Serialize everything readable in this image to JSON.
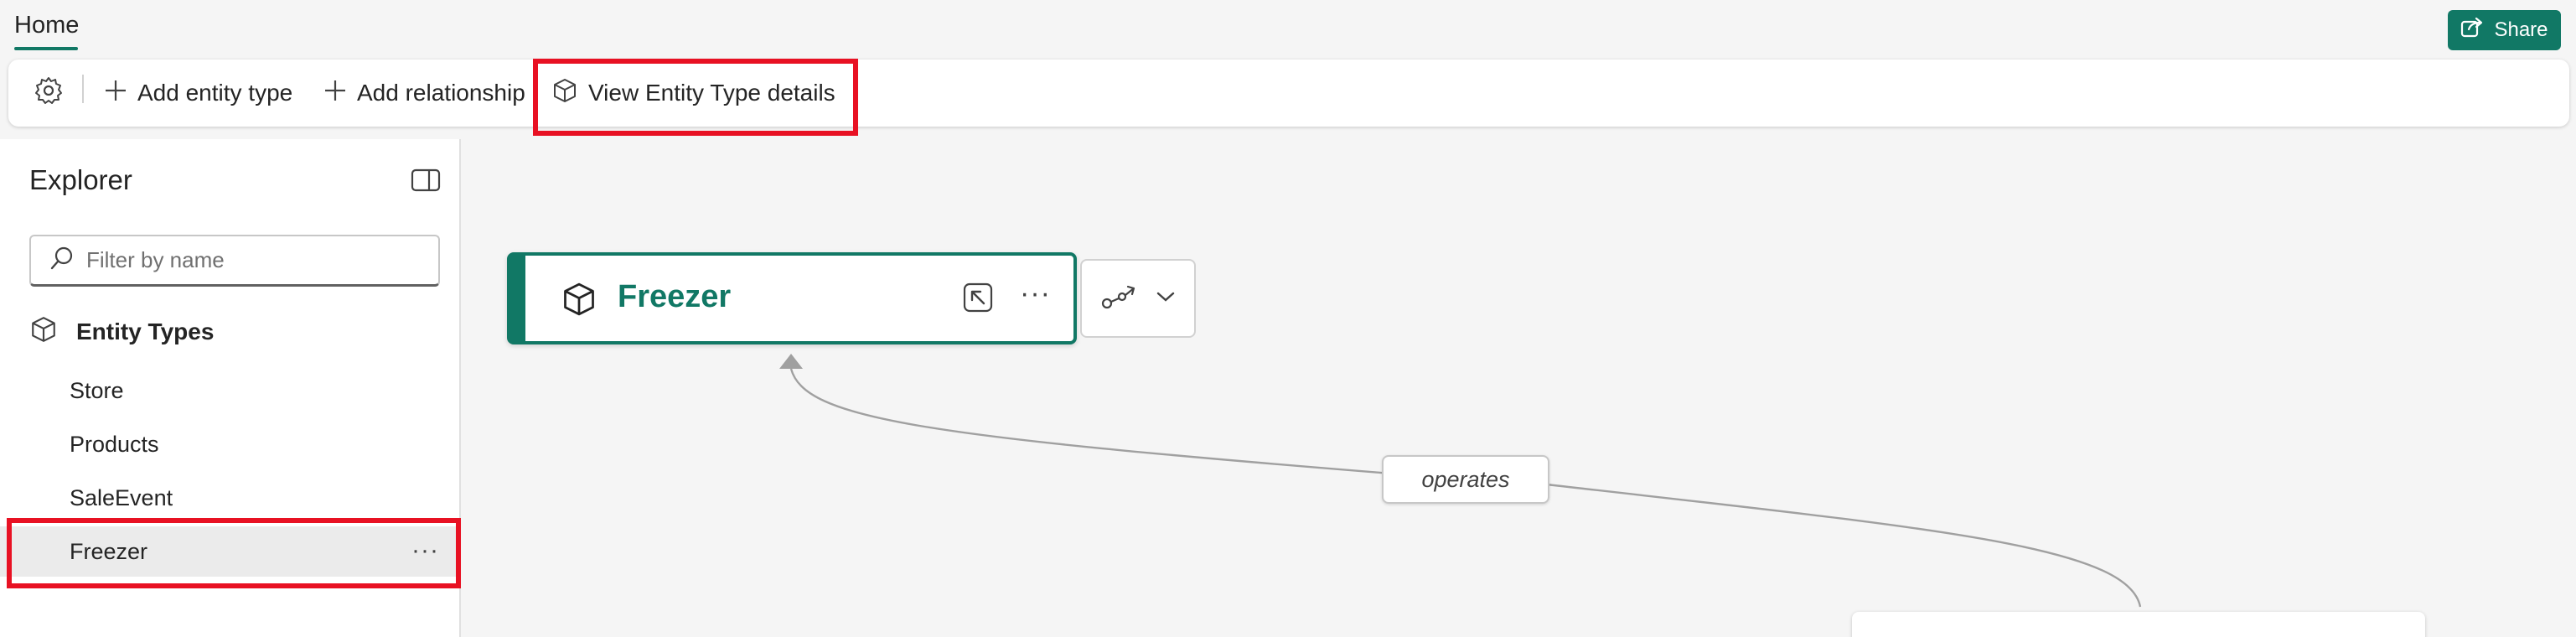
{
  "header": {
    "home_tab": "Home",
    "share_label": "Share"
  },
  "toolbar": {
    "settings_icon": "gear-icon",
    "add_entity_type": "Add entity type",
    "add_relationship": "Add relationship",
    "view_entity_details": "View Entity Type details"
  },
  "explorer": {
    "title": "Explorer",
    "filter_placeholder": "Filter by name",
    "section_title": "Entity Types",
    "items": [
      {
        "label": "Store"
      },
      {
        "label": "Products"
      },
      {
        "label": "SaleEvent"
      },
      {
        "label": "Freezer",
        "selected": true
      }
    ],
    "item_more": "···"
  },
  "canvas": {
    "entity_name": "Freezer",
    "node_more": "···",
    "relationship_label": "operates"
  },
  "colors": {
    "accent": "#117865",
    "highlight": "#e81123"
  }
}
